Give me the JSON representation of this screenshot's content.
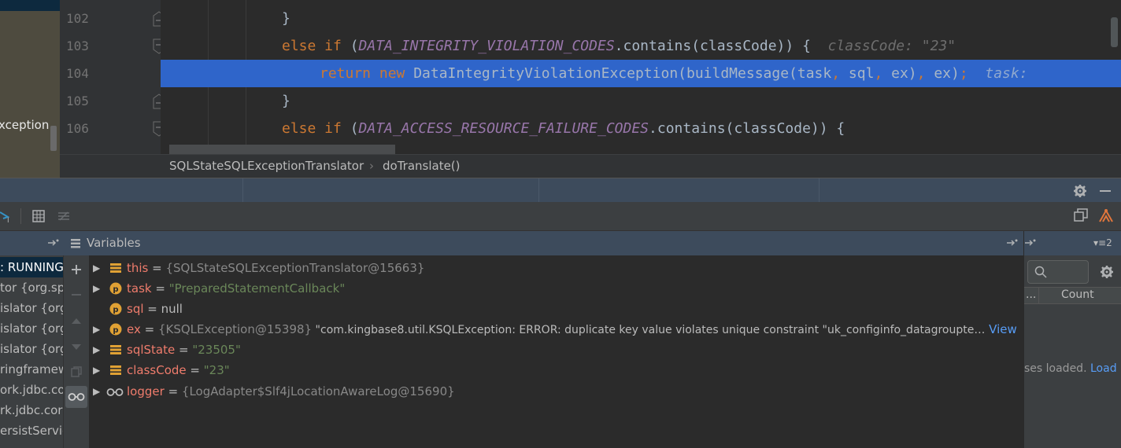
{
  "left_panel": {
    "text": "xception"
  },
  "editor": {
    "lines": [
      {
        "number": "102"
      },
      {
        "number": "103"
      },
      {
        "number": "104"
      },
      {
        "number": "105"
      },
      {
        "number": "106"
      }
    ],
    "line102_text": "}",
    "line103": {
      "else_if": "else if",
      "open": " (",
      "const": "DATA_INTEGRITY_VIOLATION_CODES",
      "rest": ".contains(classCode)) {",
      "hint": "  classCode: \"23\""
    },
    "line104": {
      "return_new": "return new",
      "call": " DataIntegrityViolationException(buildMessage(task",
      "comma1": ",",
      "sql": " sql",
      "comma2": ",",
      "ex": " ex)",
      "comma3": ",",
      "ex2": " ex)",
      "semi": ";",
      "hint": "  task: "
    },
    "line105_text": "}",
    "line106": {
      "else_if": "else if",
      "open": " (",
      "const": "DATA_ACCESS_RESOURCE_FAILURE_CODES",
      "rest": ".contains(classCode)) {"
    }
  },
  "breadcrumb": {
    "class_name": "SQLStateSQLExceptionTranslator",
    "separator": "›",
    "method": "doTranslate()"
  },
  "frames": {
    "header_icon": "pin-icon",
    "items": [
      ": RUNNING",
      "tor {org.spr",
      "islator {org.",
      "islator {org.",
      "islator {org.",
      "ringframew",
      "ork.jdbc.cor",
      "rk.jdbc.core",
      "ersistService"
    ]
  },
  "variables": {
    "title": "Variables",
    "rows": [
      {
        "expand": "▶",
        "icon": "field-icon",
        "name": "this",
        "eq": " = ",
        "ref": "{SQLStateSQLExceptionTranslator@15663}",
        "value": ""
      },
      {
        "expand": "▶",
        "icon": "parameter-icon",
        "name": "task",
        "eq": " = ",
        "ref": "",
        "value": "\"PreparedStatementCallback\""
      },
      {
        "expand": "",
        "icon": "parameter-icon",
        "name": "sql",
        "eq": " = ",
        "ref": "",
        "value": "null"
      },
      {
        "expand": "▶",
        "icon": "parameter-icon",
        "name": "ex",
        "eq": " = ",
        "ref": "{KSQLException@15398}",
        "value": " \"com.kingbase8.util.KSQLException: ERROR: duplicate key value violates unique constraint \"uk_configinfo_datagroupte…",
        "link": "View"
      },
      {
        "expand": "▶",
        "icon": "field-icon",
        "name": "sqlState",
        "eq": " = ",
        "ref": "",
        "value": "\"23505\""
      },
      {
        "expand": "▶",
        "icon": "field-icon",
        "name": "classCode",
        "eq": " = ",
        "ref": "",
        "value": "\"23\""
      },
      {
        "expand": "▶",
        "icon": "watch-icon",
        "name": "logger",
        "eq": " = ",
        "ref": "{LogAdapter$Slf4jLocationAwareLog@15690}",
        "value": ""
      }
    ]
  },
  "watches": {
    "header_label": "▾≡2",
    "col_dots": "...",
    "col_count": "Count",
    "status": "ses loaded.",
    "load_link": "Load"
  },
  "parameter_badge": "p"
}
